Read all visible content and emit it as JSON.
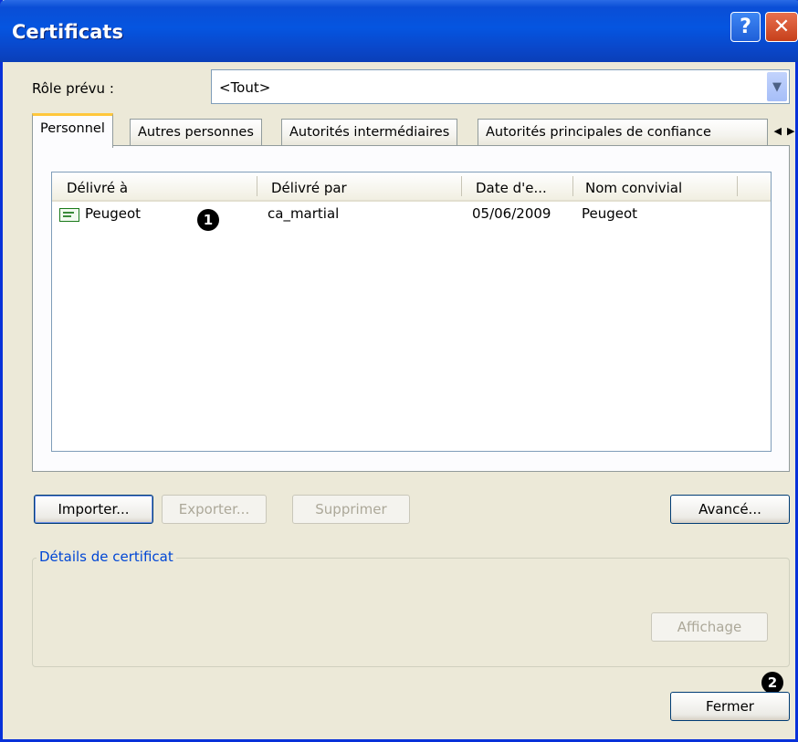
{
  "window": {
    "title": "Certificats",
    "help_glyph": "?",
    "close_glyph": "✕"
  },
  "role": {
    "label": "Rôle prévu :",
    "value": "<Tout>"
  },
  "tabs": [
    {
      "label": "Personnel",
      "active": true
    },
    {
      "label": "Autres personnes",
      "active": false
    },
    {
      "label": "Autorités intermédiaires",
      "active": false
    },
    {
      "label": "Autorités principales de confiance",
      "active": false
    }
  ],
  "list": {
    "columns": [
      "Délivré à",
      "Délivré par",
      "Date d'e...",
      "Nom convivial"
    ],
    "rows": [
      {
        "issued_to": "Peugeot",
        "issued_by": "ca_martial",
        "date": "05/06/2009",
        "friendly_name": "Peugeot"
      }
    ]
  },
  "buttons": {
    "import": "Importer...",
    "export": "Exporter...",
    "delete": "Supprimer",
    "advanced": "Avancé...",
    "view": "Affichage",
    "close": "Fermer"
  },
  "details_group": {
    "legend": "Détails de certificat"
  },
  "callouts": [
    "1",
    "2"
  ],
  "icons": {
    "help": "question-mark-icon",
    "close": "close-x-icon",
    "dropdown": "chevron-down-icon",
    "certificate": "certificate-icon",
    "tab_scroll_left": "arrow-left-icon",
    "tab_scroll_right": "arrow-right-icon"
  },
  "colors": {
    "titlebar": "#0555e0",
    "window_bg": "#ece9d8",
    "active_tab_accent": "#ffc73c",
    "group_legend": "#0046d5"
  }
}
